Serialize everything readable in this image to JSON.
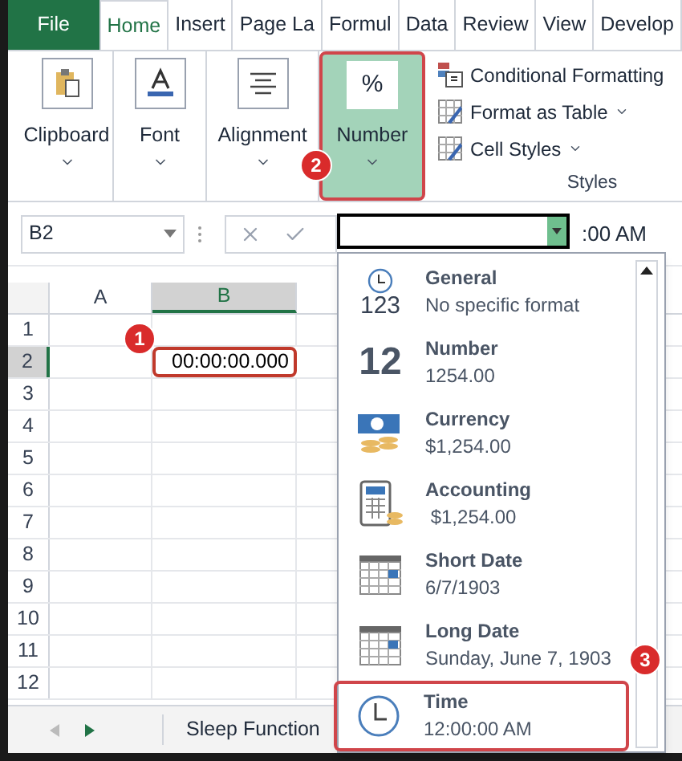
{
  "tabs": [
    {
      "label": "File",
      "selected": false,
      "kind": "file"
    },
    {
      "label": "Home",
      "selected": true,
      "kind": "tab"
    },
    {
      "label": "Insert",
      "selected": false,
      "kind": "tab"
    },
    {
      "label": "Page La",
      "selected": false,
      "kind": "tab"
    },
    {
      "label": "Formul",
      "selected": false,
      "kind": "tab"
    },
    {
      "label": "Data",
      "selected": false,
      "kind": "tab"
    },
    {
      "label": "Review",
      "selected": false,
      "kind": "tab"
    },
    {
      "label": "View",
      "selected": false,
      "kind": "tab"
    },
    {
      "label": "Develop",
      "selected": false,
      "kind": "tab"
    }
  ],
  "ribbon_groups": [
    {
      "label": "Clipboard",
      "kind": "clipboard",
      "highlighted": false
    },
    {
      "label": "Font",
      "kind": "font",
      "highlighted": false
    },
    {
      "label": "Alignment",
      "kind": "align",
      "highlighted": false
    },
    {
      "label": "Number",
      "kind": "percent",
      "symbol": "%",
      "highlighted": true
    }
  ],
  "styles_group": {
    "items": [
      {
        "label": "Conditional Formatting",
        "kind": "conditional",
        "has_menu": false
      },
      {
        "label": "Format as Table",
        "kind": "table",
        "has_menu": true
      },
      {
        "label": "Cell Styles",
        "kind": "cellstyles",
        "has_menu": true
      }
    ],
    "label": "Styles"
  },
  "name_box": "B2",
  "formula_text": ":00 AM",
  "columns": [
    {
      "label": "A",
      "selected": false
    },
    {
      "label": "B",
      "selected": true
    }
  ],
  "rows": [
    {
      "label": "1",
      "selected": false
    },
    {
      "label": "2",
      "selected": true,
      "value": "00:00:00.000"
    },
    {
      "label": "3",
      "selected": false
    },
    {
      "label": "4",
      "selected": false
    },
    {
      "label": "5",
      "selected": false
    },
    {
      "label": "6",
      "selected": false
    },
    {
      "label": "7",
      "selected": false
    },
    {
      "label": "8",
      "selected": false
    },
    {
      "label": "9",
      "selected": false
    },
    {
      "label": "10",
      "selected": false
    },
    {
      "label": "11",
      "selected": false
    },
    {
      "label": "12",
      "selected": false
    }
  ],
  "format_menu": [
    {
      "name": "General",
      "example": "No specific format",
      "kind": "general",
      "icon_text": "123",
      "selected": false
    },
    {
      "name": "Number",
      "example": "1254.00",
      "kind": "number",
      "icon_text": "12",
      "selected": false
    },
    {
      "name": "Currency",
      "example": "$1,254.00",
      "kind": "currency",
      "selected": false
    },
    {
      "name": "Accounting",
      "example": " $1,254.00",
      "kind": "accounting",
      "selected": false
    },
    {
      "name": "Short Date",
      "example": "6/7/1903",
      "kind": "calendar",
      "selected": false
    },
    {
      "name": "Long Date",
      "example": "Sunday, June 7, 1903",
      "kind": "calendar",
      "selected": false
    },
    {
      "name": "Time",
      "example": "12:00:00 AM",
      "kind": "clock",
      "selected": true
    }
  ],
  "sheet_tab": "Sleep Function",
  "callouts": [
    "1",
    "2",
    "3"
  ]
}
